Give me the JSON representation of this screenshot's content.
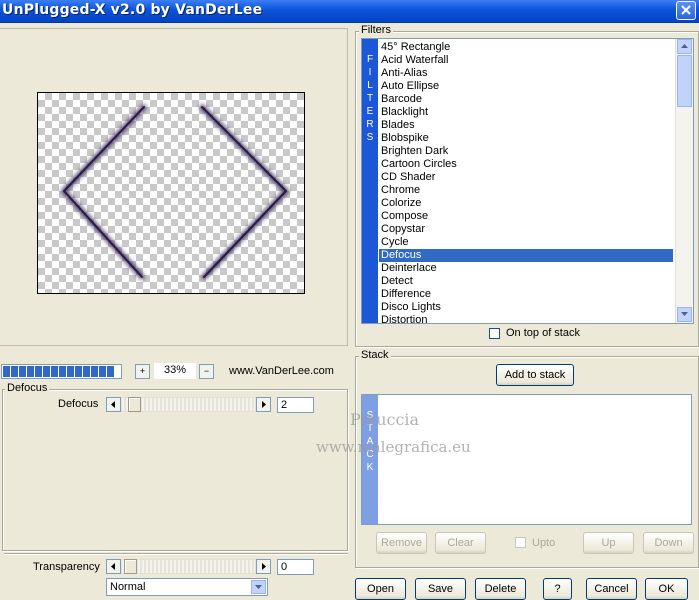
{
  "window": {
    "title": "UnPlugged-X v2.0 by VanDerLee"
  },
  "zoom": {
    "value": "33%",
    "plus": "+",
    "minus": "−"
  },
  "progress": {
    "segments": 14
  },
  "website": "www.VanDerLee.com",
  "filters": {
    "group_title": "Filters",
    "strip_letters": [
      "F",
      "I",
      "L",
      "T",
      "E",
      "R",
      "S"
    ],
    "items": [
      "45° Rectangle",
      "Acid Waterfall",
      "Anti-Alias",
      "Auto Ellipse",
      "Barcode",
      "Blacklight",
      "Blades",
      "Blobspike",
      "Brighten Dark",
      "Cartoon Circles",
      "CD Shader",
      "Chrome",
      "Colorize",
      "Compose",
      "Copystar",
      "Cycle",
      "Defocus",
      "Deinterlace",
      "Detect",
      "Difference",
      "Disco Lights",
      "Distortion"
    ],
    "selected_index": 16,
    "on_top_label": "On top of stack"
  },
  "params": {
    "group_title": "Defocus",
    "defocus_label": "Defocus",
    "defocus_value": "2",
    "transparency_label": "Transparency",
    "transparency_value": "0",
    "blend_mode": "Normal"
  },
  "stack": {
    "group_title": "Stack",
    "add_label": "Add to stack",
    "strip_letters": [
      "S",
      "T",
      "A",
      "C",
      "K"
    ],
    "remove_label": "Remove",
    "clear_label": "Clear",
    "upto_label": "Upto",
    "up_label": "Up",
    "down_label": "Down"
  },
  "watermark": {
    "line1": "Pinuccia",
    "line2": "www.malegrafica.eu"
  },
  "footer": {
    "open": "Open",
    "save": "Save",
    "delete": "Delete",
    "help": "?",
    "cancel": "Cancel",
    "ok": "OK"
  },
  "colors": {
    "accent": "#316ac5",
    "strip": "#1c57d8",
    "titlebar": "#0a53d8",
    "shape": "#3b2b5c"
  }
}
